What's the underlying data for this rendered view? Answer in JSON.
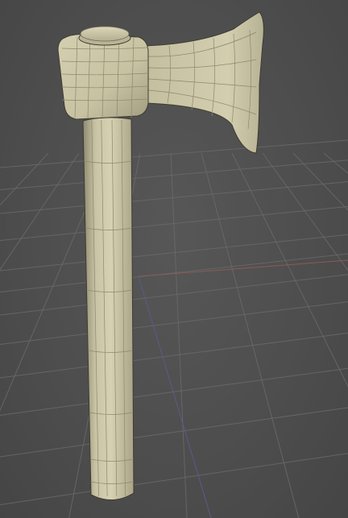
{
  "viewport": {
    "background": "#4e4e4e",
    "grid_color": "#6a6a6a",
    "x_axis_color": "#8a5a5a",
    "y_axis_color": "#5a5a8a"
  },
  "model": {
    "name": "axe",
    "material_color": "#c8c3a3",
    "wire_color": "#8d8870"
  }
}
